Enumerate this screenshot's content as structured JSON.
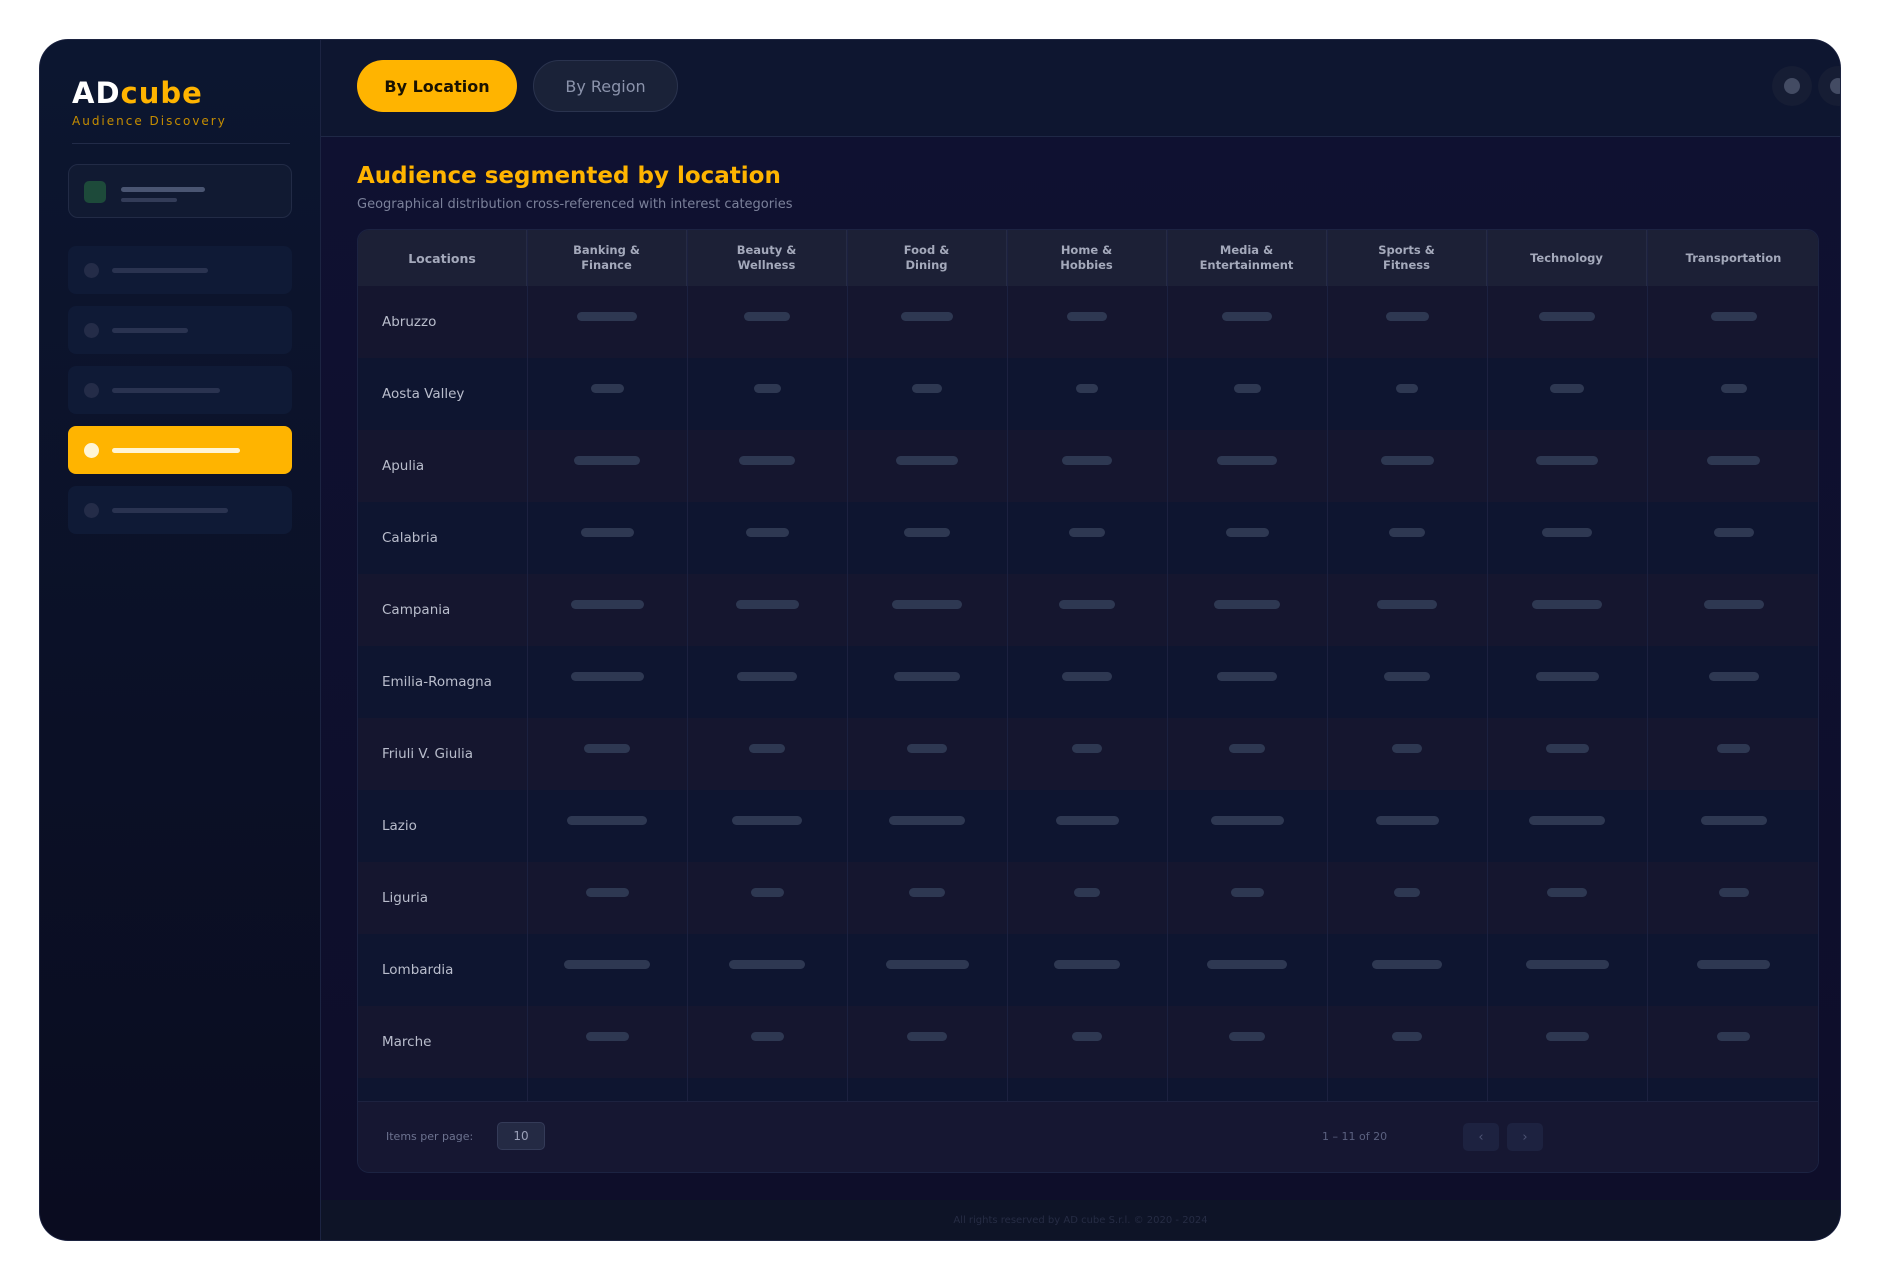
{
  "brand": {
    "name_part1": "AD",
    "name_part2": "cube",
    "tagline": "Audience Discovery"
  },
  "tabs": [
    {
      "label": "By Location",
      "active": true
    },
    {
      "label": "By Region",
      "active": false
    }
  ],
  "page": {
    "title": "Audience segmented by location",
    "subtitle": "Geographical distribution cross-referenced with interest categories"
  },
  "table": {
    "columns": [
      "Locations",
      "Banking &\nFinance",
      "Beauty &\nWellness",
      "Food &\nDining",
      "Home &\nHobbies",
      "Media &\nEntertainment",
      "Sports &\nFitness",
      "Technology",
      "Transportation"
    ],
    "rows": [
      {
        "location": "Abruzzo"
      },
      {
        "location": "Aosta Valley"
      },
      {
        "location": "Apulia"
      },
      {
        "location": "Calabria"
      },
      {
        "location": "Campania"
      },
      {
        "location": "Emilia-Romagna"
      },
      {
        "location": "Friuli V. Giulia"
      },
      {
        "location": "Lazio"
      },
      {
        "location": "Liguria"
      },
      {
        "location": "Lombardia"
      },
      {
        "location": "Marche"
      }
    ]
  },
  "pagination": {
    "items_per_page_label": "Items per page:",
    "items_per_page_value": "10",
    "range_text": "1 – 11 of 20",
    "prev_icon": "‹",
    "next_icon": "›"
  },
  "footer": {
    "copyright": "All rights reserved by AD cube S.r.l. © 2020 - 2024"
  },
  "colors": {
    "accent": "#ffb400",
    "background": "#0d1227",
    "sidebar": "#0b1026"
  }
}
